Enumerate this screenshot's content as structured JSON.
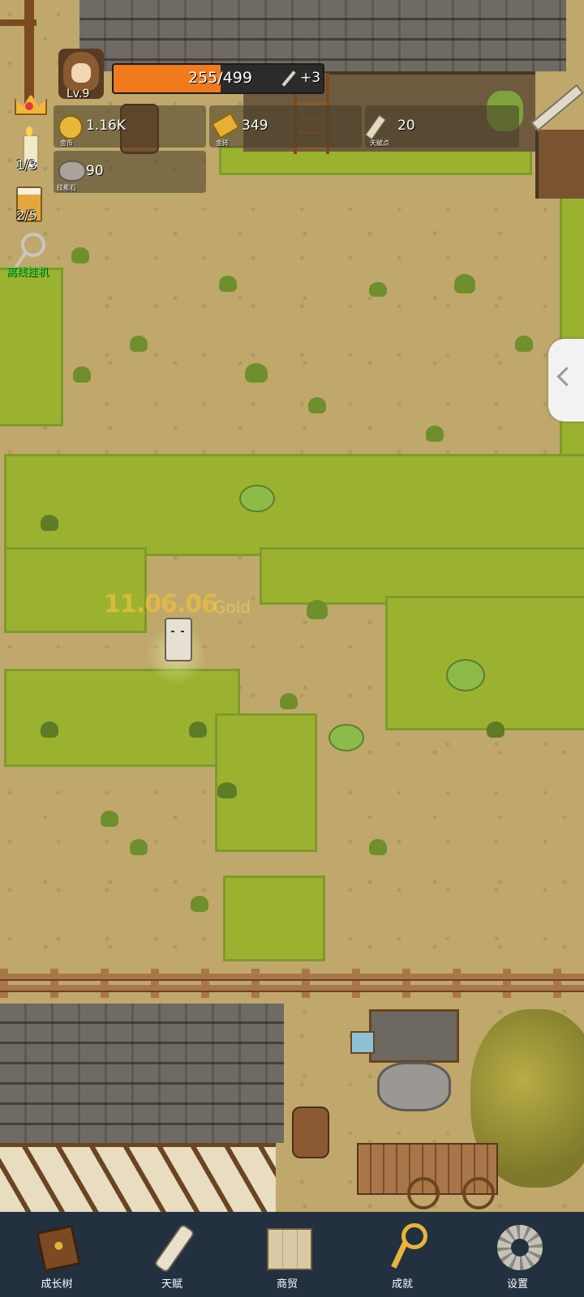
{
  "player": {
    "level_label": "Lv.9"
  },
  "xp_bar": {
    "text": "255/499",
    "progress": 0.511,
    "bonus_label": "+3"
  },
  "resources": [
    {
      "name": "gold-coin",
      "value": "1.16K",
      "caption": "金币"
    },
    {
      "name": "gold-ingot",
      "value": "349",
      "caption": "金砖"
    },
    {
      "name": "talent-point",
      "value": "20",
      "caption": "天赋点"
    },
    {
      "name": "skill-stone",
      "value": "90",
      "caption": "技能石"
    }
  ],
  "side_items": {
    "crown_icon": "crown-icon",
    "candle_count": "1/3",
    "beer_count": "2/5",
    "idle_label": "离线挂机"
  },
  "floating_text": {
    "amount": "11.06.06",
    "currency": "Gold"
  },
  "nav": [
    {
      "label": "成长树",
      "icon": "book-icon"
    },
    {
      "label": "天赋",
      "icon": "scroll-icon"
    },
    {
      "label": "商贸",
      "icon": "map-icon"
    },
    {
      "label": "成就",
      "icon": "key-icon"
    },
    {
      "label": "设置",
      "icon": "gear-icon"
    }
  ],
  "colors": {
    "xp_fill": "#f07a1c",
    "nav_bg": "#233040",
    "grass": "#9bb231",
    "dirt": "#c0a86c",
    "idle_label": "#39e33b"
  }
}
